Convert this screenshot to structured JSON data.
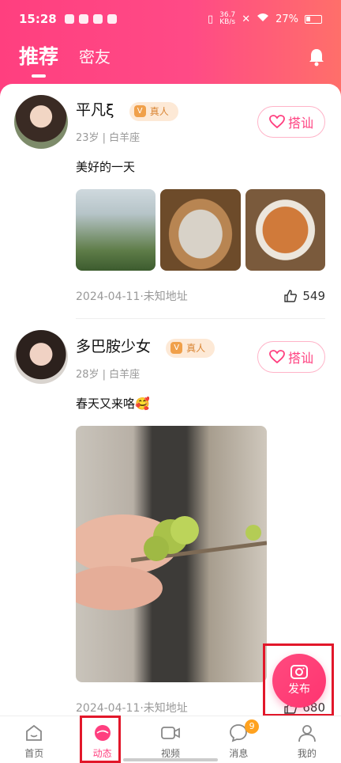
{
  "status_bar": {
    "time": "15:28",
    "net_speed_top": "36.7",
    "net_speed_bottom": "KB/s",
    "battery": "27%"
  },
  "tabs": [
    {
      "label": "推荐",
      "active": true
    },
    {
      "label": "密友",
      "active": false
    }
  ],
  "posts": [
    {
      "name": "平凡ξ",
      "verified_label": "真人",
      "meta": "23岁 | 白羊座",
      "text": "美好的一天",
      "chat_label": "搭讪",
      "date_location": "2024-04-11·未知地址",
      "likes": "549",
      "images": [
        "greenhouse",
        "food-plate",
        "spicy-dish"
      ]
    },
    {
      "name": "多巴胺少女",
      "verified_label": "真人",
      "meta": "28岁 | 白羊座",
      "text": "春天又来咯🥰",
      "chat_label": "搭讪",
      "date_location": "2024-04-11·未知地址",
      "likes": "680",
      "images": [
        "budding-branch"
      ]
    }
  ],
  "fab": {
    "label": "发布"
  },
  "bottom_nav": [
    {
      "label": "首页",
      "icon": "home-icon",
      "active": false
    },
    {
      "label": "动态",
      "icon": "moments-icon",
      "active": true
    },
    {
      "label": "视频",
      "icon": "video-icon",
      "active": false
    },
    {
      "label": "消息",
      "icon": "message-icon",
      "active": false,
      "badge": "9"
    },
    {
      "label": "我的",
      "icon": "profile-icon",
      "active": false
    }
  ],
  "colors": {
    "brand": "#ff3f7f",
    "verify": "#f0a04a",
    "highlight": "#e2172a"
  }
}
